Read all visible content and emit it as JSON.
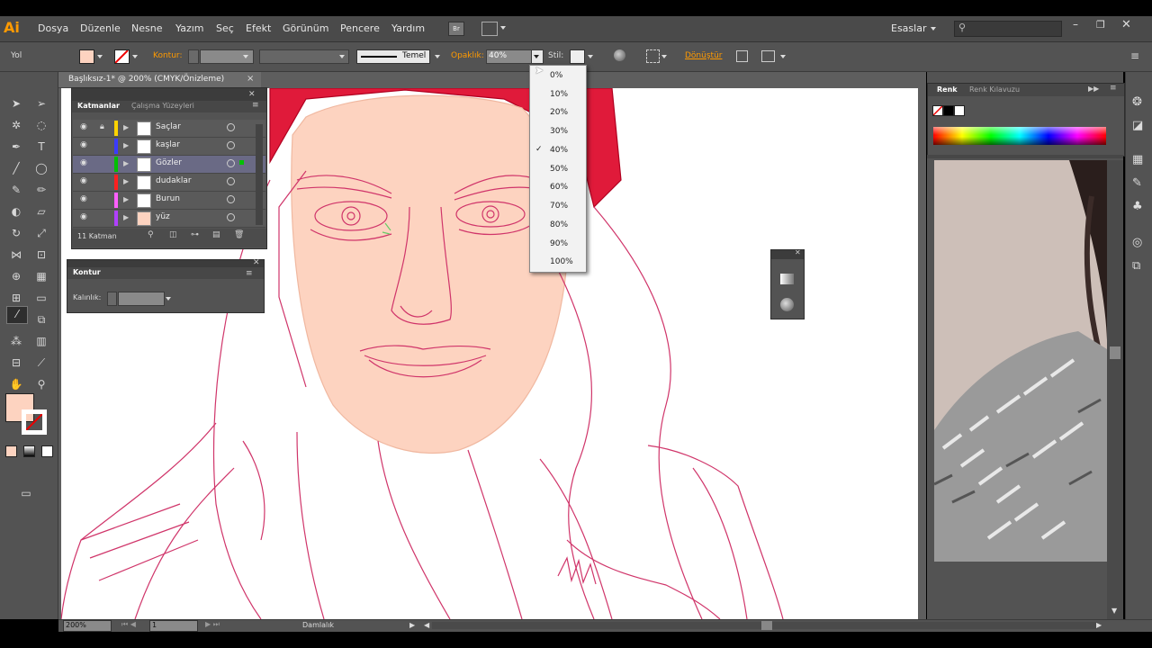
{
  "app": {
    "logo": "Ai"
  },
  "menu": [
    "Dosya",
    "Düzenle",
    "Nesne",
    "Yazım",
    "Seç",
    "Efekt",
    "Görünüm",
    "Pencere",
    "Yardım"
  ],
  "menu_extra": {
    "br": "Br",
    "workspace": "Esaslar"
  },
  "control": {
    "selection": "Yol",
    "stroke_label": "Kontur:",
    "stroke_style": "Temel",
    "opacity_label": "Opaklık:",
    "opacity_value": "40%",
    "style_label": "Stil:",
    "transform_label": "Dönüştür"
  },
  "document": {
    "tab_title": "Başlıksız-1* @ 200% (CMYK/Önizleme)"
  },
  "layers_panel": {
    "tabs": [
      "Katmanlar",
      "Çalışma Yüzeyleri"
    ],
    "layers": [
      {
        "name": "Saçlar",
        "color": "#ffd400",
        "locked": true
      },
      {
        "name": "kaşlar",
        "color": "#3b3bff",
        "locked": false
      },
      {
        "name": "Gözler",
        "color": "#00c000",
        "locked": false,
        "selected": true
      },
      {
        "name": "dudaklar",
        "color": "#ff2020",
        "locked": false
      },
      {
        "name": "Burun",
        "color": "#ff60ff",
        "locked": false
      },
      {
        "name": "yüz",
        "color": "#b040ff",
        "locked": false
      }
    ],
    "count_label": "11 Katman"
  },
  "stroke_panel": {
    "title": "Kontur",
    "weight_label": "Kalınlık:"
  },
  "opacity_options": [
    "0%",
    "10%",
    "20%",
    "30%",
    "40%",
    "50%",
    "60%",
    "70%",
    "80%",
    "90%",
    "100%"
  ],
  "opacity_selected": "40%",
  "color_panel": {
    "tabs": [
      "Renk",
      "Renk Kılavuzu"
    ]
  },
  "status": {
    "zoom": "200%",
    "page": "1",
    "tool": "Damlalık"
  },
  "colors": {
    "fill": "#fdd3c0",
    "accent": "#ff9a00",
    "artwork_line": "#d0356a",
    "hair": "#e01a3a"
  }
}
